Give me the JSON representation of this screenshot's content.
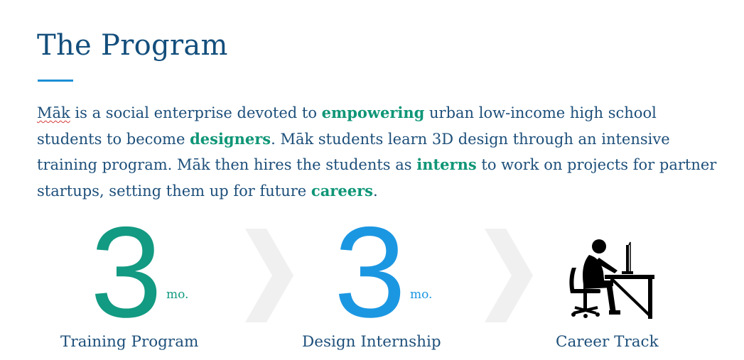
{
  "title": "The Program",
  "intro": {
    "brand": "Māk",
    "seg1": " is a social enterprise devoted to ",
    "hl1": "empowering",
    "seg2": " urban low-income high school students to become ",
    "hl2": "designers",
    "seg3": ". Māk students learn 3D design through an intensive training program. Māk then hires the students as ",
    "hl3": "interns",
    "seg4": " to work on projects for partner startups, setting them up for future ",
    "hl4": "careers",
    "seg5": "."
  },
  "steps": [
    {
      "number": "3",
      "unit": "mo.",
      "label": "Training Program",
      "color": "#129a82"
    },
    {
      "number": "3",
      "unit": "mo.",
      "label": "Design Internship",
      "color": "#1b97e2"
    },
    {
      "label": "Career Track",
      "icon": "person-at-desk-icon"
    }
  ],
  "colors": {
    "title": "#134e7c",
    "body_text": "#1d4f7a",
    "highlight": "#0f9677",
    "accent_rule": "#1c8fd6",
    "chevron": "#f0f0f0"
  }
}
